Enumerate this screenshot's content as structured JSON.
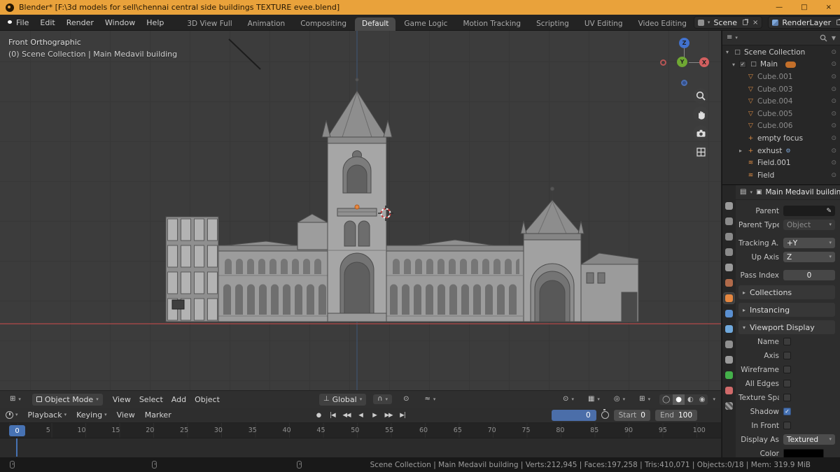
{
  "glyphs": {
    "caret": "▾",
    "caret_right": "▸",
    "close": "×",
    "minimize": "—",
    "maximize": "□",
    "editor_3d": "⊞",
    "editor_outliner": "≡",
    "editor_props": "▤",
    "orientation": "⊥",
    "magnet": "∩",
    "prop_edit": "⊙",
    "falloff": "≈",
    "object_breadcrumb": "▣",
    "eyedropper": "✎",
    "funnel": "▼"
  },
  "titlebar": {
    "title": "Blender* [F:\\3d models for sell\\chennai central side buildings TEXTURE evee.blend]"
  },
  "menubar": {
    "menus": [
      {
        "label": "File"
      },
      {
        "label": "Edit"
      },
      {
        "label": "Render"
      },
      {
        "label": "Window"
      },
      {
        "label": "Help"
      }
    ],
    "workspaces": [
      {
        "label": "3D View Full"
      },
      {
        "label": "Animation"
      },
      {
        "label": "Compositing"
      },
      {
        "label": "Default",
        "active": true
      },
      {
        "label": "Game Logic"
      },
      {
        "label": "Motion Tracking"
      },
      {
        "label": "Scripting"
      },
      {
        "label": "UV Editing"
      },
      {
        "label": "Video Editing"
      }
    ],
    "scene_name": "Scene",
    "render_layer_name": "RenderLayer"
  },
  "viewport": {
    "view_label": "Front Orthographic",
    "context_label": "(0) Scene Collection | Main Medavil building",
    "axis_x": "X",
    "axis_y": "Y",
    "axis_z": "Z",
    "header": {
      "mode_label": "Object Mode",
      "menus": [
        {
          "label": "View"
        },
        {
          "label": "Select"
        },
        {
          "label": "Add"
        },
        {
          "label": "Object"
        }
      ],
      "orientation_label": "Global",
      "right_icons": [
        {
          "name": "visibility-dropdown-icon",
          "glyph": "⊙",
          "caret": true
        },
        {
          "name": "gizmos-dropdown-icon",
          "glyph": "▦",
          "caret": true
        },
        {
          "name": "overlays-dropdown-icon",
          "glyph": "◎",
          "caret": true
        },
        {
          "name": "xray-toggle-icon",
          "glyph": "⊞",
          "caret": false
        }
      ],
      "shading_modes": [
        {
          "name": "wireframe-shading-button",
          "glyph": "◯"
        },
        {
          "name": "solid-shading-button",
          "glyph": "●",
          "active": true
        },
        {
          "name": "material-shading-button",
          "glyph": "◐"
        },
        {
          "name": "rendered-shading-button",
          "glyph": "◉"
        }
      ]
    }
  },
  "outliner": {
    "rows": [
      {
        "label": "Scene Collection",
        "icon": "collection-icon",
        "glyph": "□",
        "disc": "▾",
        "right": "⊙"
      },
      {
        "label": "Main",
        "icon": "collection-icon",
        "glyph": "□",
        "disc": "▾",
        "i1": true,
        "checkbox": true,
        "badge": true,
        "right": "⊙"
      },
      {
        "label": "Cube.001",
        "icon": "mesh-icon",
        "glyph": "▽",
        "orange": true,
        "dim": true,
        "i2": true,
        "right": "⊙"
      },
      {
        "label": "Cube.003",
        "icon": "mesh-icon",
        "glyph": "▽",
        "orange": true,
        "dim": true,
        "i2": true,
        "right": "⊙"
      },
      {
        "label": "Cube.004",
        "icon": "mesh-icon",
        "glyph": "▽",
        "orange": true,
        "dim": true,
        "i2": true,
        "right": "⊙"
      },
      {
        "label": "Cube.005",
        "icon": "mesh-icon",
        "glyph": "▽",
        "orange": true,
        "dim": true,
        "i2": true,
        "right": "⊙"
      },
      {
        "label": "Cube.006",
        "icon": "mesh-icon",
        "glyph": "▽",
        "orange": true,
        "dim": true,
        "i2": true,
        "right": "⊙"
      },
      {
        "label": "empty focus",
        "icon": "empty-icon",
        "glyph": "+",
        "orange": true,
        "i2": true,
        "right": "⊙"
      },
      {
        "label": "exhust",
        "icon": "empty-icon",
        "glyph": "+",
        "orange": true,
        "i2": true,
        "disc": "▸",
        "extra": "⚙",
        "right": "⊙"
      },
      {
        "label": "Field.001",
        "icon": "force-field-icon",
        "glyph": "≋",
        "orange": true,
        "i2": true,
        "right": "⊙"
      },
      {
        "label": "Field",
        "icon": "force-field-icon",
        "glyph": "≋",
        "orange": true,
        "i2": true,
        "right": "⊙"
      }
    ]
  },
  "properties": {
    "object_name": "Main Medavil building",
    "tabs": [
      {
        "name": "properties-tab-tool-icon",
        "color": "#9a9a9a"
      },
      {
        "name": "properties-tab-render-icon",
        "color": "#8a8a8a"
      },
      {
        "name": "properties-tab-output-icon",
        "color": "#8a8a8a"
      },
      {
        "name": "properties-tab-view-layer-icon",
        "color": "#8a8a8a"
      },
      {
        "name": "properties-tab-scene-icon",
        "color": "#9a9a9a"
      },
      {
        "name": "properties-tab-world-icon",
        "color": "#b06a4a"
      },
      {
        "name": "properties-tab-object-icon",
        "color": "#e58740",
        "active": true
      },
      {
        "name": "properties-tab-modifiers-icon",
        "color": "#5a8fd0"
      },
      {
        "name": "properties-tab-particles-icon",
        "color": "#6fa8dc"
      },
      {
        "name": "properties-tab-physics-icon",
        "color": "#8f8f8f"
      },
      {
        "name": "properties-tab-constraints-icon",
        "color": "#9a9a9a"
      },
      {
        "name": "properties-tab-object-data-icon",
        "color": "#44b04a"
      },
      {
        "name": "properties-tab-material-icon",
        "color": "#d06a6a"
      },
      {
        "name": "properties-tab-texture-icon",
        "color": "#777777",
        "checker": true
      }
    ],
    "parent_label": "Parent",
    "parent_type_label": "Parent Type",
    "parent_type_value": "Object",
    "tracking_label": "Tracking A...",
    "tracking_value": "+Y",
    "up_axis_label": "Up Axis",
    "up_axis_value": "Z",
    "pass_index_label": "Pass Index",
    "pass_index_value": "0",
    "collections_section": "Collections",
    "instancing_section": "Instancing",
    "viewport_display_section": "Viewport Display",
    "display_checks": [
      {
        "label": "Name"
      },
      {
        "label": "Axis"
      },
      {
        "label": "Wireframe"
      },
      {
        "label": "All Edges"
      },
      {
        "label": "Texture Space"
      },
      {
        "label": "Shadow",
        "checked": true
      },
      {
        "label": "In Front"
      }
    ],
    "display_as_label": "Display As",
    "display_as_value": "Textured",
    "color_label": "Color"
  },
  "timeline": {
    "menus": [
      {
        "label": "Playback",
        "caret": true
      },
      {
        "label": "Keying",
        "caret": true
      },
      {
        "label": "View"
      },
      {
        "label": "Marker"
      }
    ],
    "playback": [
      {
        "name": "record-button",
        "glyph": "●"
      },
      {
        "name": "jump-to-start-button",
        "glyph": "|◀"
      },
      {
        "name": "previous-keyframe-button",
        "glyph": "◀◀"
      },
      {
        "name": "play-reverse-button",
        "glyph": "◀"
      },
      {
        "name": "play-button",
        "glyph": "▶"
      },
      {
        "name": "next-keyframe-button",
        "glyph": "▶▶"
      },
      {
        "name": "jump-to-end-button",
        "glyph": "▶|"
      }
    ],
    "current_frame": "0",
    "start_label": "Start",
    "start_value": "0",
    "end_label": "End",
    "end_value": "100",
    "playhead_label": "0",
    "ticks": [
      {
        "v": "0"
      },
      {
        "v": "5"
      },
      {
        "v": "10"
      },
      {
        "v": "15"
      },
      {
        "v": "20"
      },
      {
        "v": "25"
      },
      {
        "v": "30"
      },
      {
        "v": "35"
      },
      {
        "v": "40"
      },
      {
        "v": "45"
      },
      {
        "v": "50"
      },
      {
        "v": "55"
      },
      {
        "v": "60"
      },
      {
        "v": "65"
      },
      {
        "v": "70"
      },
      {
        "v": "75"
      },
      {
        "v": "80"
      },
      {
        "v": "85"
      },
      {
        "v": "90"
      },
      {
        "v": "95"
      },
      {
        "v": "100"
      }
    ]
  },
  "statusbar": {
    "info": "Scene Collection | Main Medavil building | Verts:212,945 | Faces:197,258 | Tris:410,071 | Objects:0/18 | Mem: 319.9 MiB"
  },
  "colors": {
    "titlebar_orange": "#e9a23b",
    "accent_blue": "#4772b3",
    "axis_x_red": "#9e4747",
    "selection_orange": "#e58740"
  }
}
